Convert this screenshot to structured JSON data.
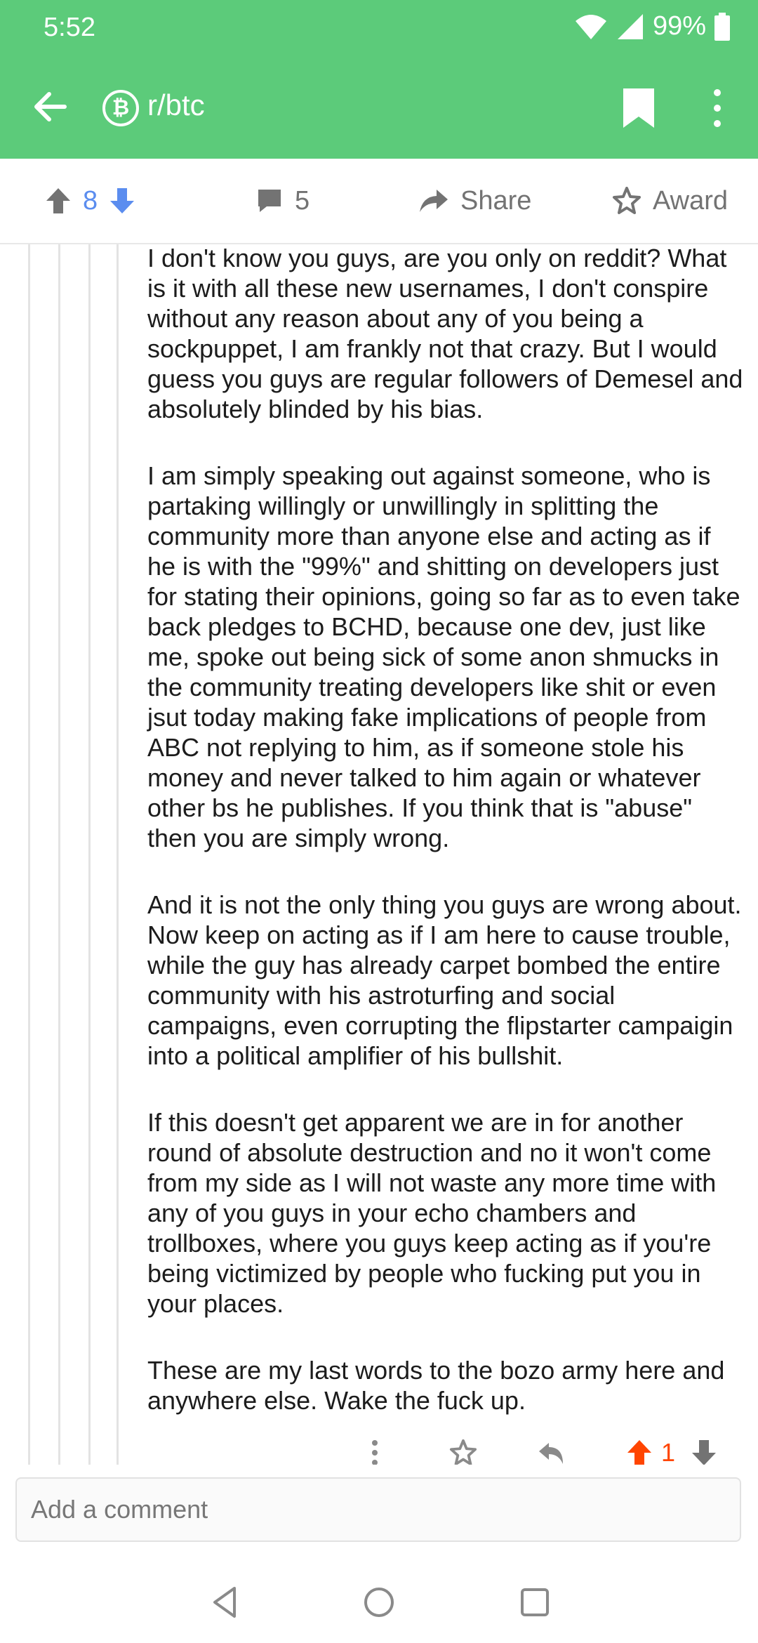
{
  "status": {
    "time": "5:52",
    "battery": "99%"
  },
  "app_bar": {
    "subreddit": "r/btc",
    "subreddit_icon_glyph": "₿"
  },
  "actions": {
    "vote_count": "8",
    "comment_count": "5",
    "share_label": "Share",
    "award_label": "Award"
  },
  "comment": {
    "paragraphs": [
      "I don't know you guys, are you only on reddit? What is it with all these new usernames, I don't conspire without any reason about any of you being a sockpuppet, I am frankly not that crazy. But I would guess you guys are regular followers of Demesel and absolutely blinded by his bias.",
      "I am simply speaking out against someone, who is partaking willingly or unwillingly in splitting the community more than anyone else and acting as if he is with the \"99%\" and shitting on developers just for stating their opinions, going so far as to even take back pledges to BCHD, because one dev, just like me, spoke out being sick of some anon shmucks in the community treating developers like shit or even jsut today making fake implications of people from ABC not replying to him, as if someone stole his money and never talked to him again or whatever other bs he publishes. If you think that is \"abuse\" then you are simply wrong.",
      "And it is not the only thing you guys are wrong about. Now keep on acting as if I am here to cause trouble, while the guy has already carpet bombed the entire community with his astroturfing and social campaigns, even corrupting the flipstarter campaigin into a political amplifier of his bullshit.",
      "If this doesn't get apparent we are in for another round of absolute destruction and no it won't come from my side as I will not waste any more time with any of you guys in your echo chambers and trollboxes, where you guys keep acting as if you're being victimized by people who fucking put you in your places.",
      "These are my last words to the bozo army here and anywhere else. Wake the fuck up."
    ],
    "upvotes": "1"
  },
  "input": {
    "placeholder": "Add a comment"
  },
  "colors": {
    "brand_green": "#5ccb7a",
    "upvote_orange": "#ff4500",
    "vote_blue": "#5b8def"
  },
  "icons": [
    "back-arrow-icon",
    "bitcoin-icon",
    "bookmark-icon",
    "more-vert-icon",
    "upvote-icon",
    "downvote-icon",
    "comment-icon",
    "share-icon",
    "award-icon",
    "reply-icon",
    "nav-back-icon",
    "nav-home-icon",
    "nav-recents-icon"
  ]
}
